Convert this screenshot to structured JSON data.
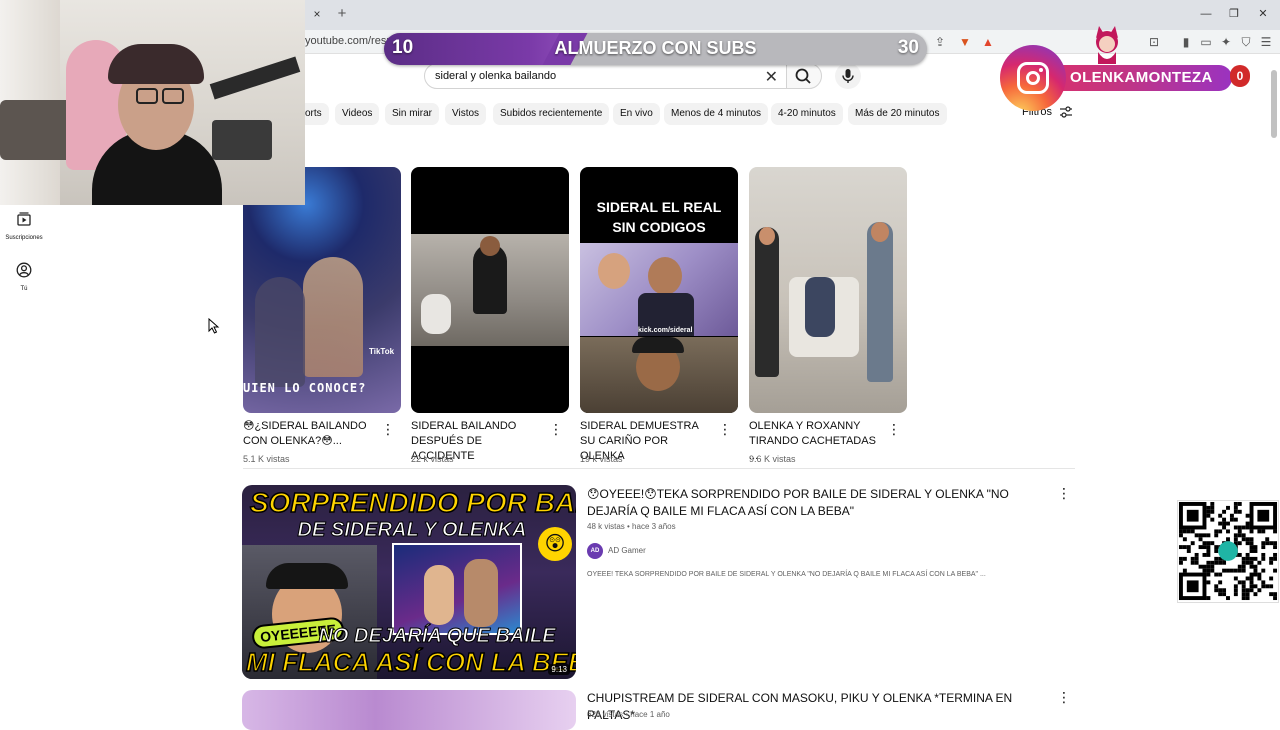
{
  "browser": {
    "url": "youtube.com/resul",
    "tab_close": "×",
    "tab_new": "+"
  },
  "overlay": {
    "goal_current": "10",
    "goal_title": "ALMUERZO CON SUBS",
    "goal_target": "30",
    "goal_progress": 0.333,
    "instagram_handle": "OLENKAMONTEZA",
    "instagram_count": "0",
    "colors": {
      "goal_fill": "#6b3399",
      "instagram": "#c13584"
    }
  },
  "search": {
    "query": "sideral y olenka bailando"
  },
  "chips": [
    "orts",
    "Videos",
    "Sin mirar",
    "Vistos",
    "Subidos recientemente",
    "En vivo",
    "Menos de 4 minutos",
    "4-20 minutos",
    "Más de 20 minutos"
  ],
  "filters_label": "Filtros",
  "sidebar": {
    "subscriptions": "Suscripciones",
    "you": "Tú"
  },
  "shorts": [
    {
      "title": "😳¿SIDERAL BAILANDO CON OLENKA?😳...",
      "views": "5.1 K vistas",
      "overlay_text": "UIEN LO CONOCE?",
      "badge": "TikTok"
    },
    {
      "title": "SIDERAL BAILANDO DESPUÉS DE ACCIDENTE",
      "views": "22 k vistas"
    },
    {
      "title": "SIDERAL DEMUESTRA SU CARIÑO POR OLENKA",
      "views": "19 k vistas",
      "overlay_text": "SIDERAL EL REAL SIN CODIGOS",
      "watermark": "kick.com/sideral"
    },
    {
      "title": "OLENKA Y ROXANNY TIRANDO CACHETADAS ...",
      "views": "9.6 K vistas"
    }
  ],
  "videos": [
    {
      "title": "😯OYEEE!😯TEKA SORPRENDIDO POR BAILE DE SIDERAL Y OLENKA \"NO DEJARÍA Q BAILE MI FLACA ASÍ CON LA BEBA\"",
      "meta": "48 k vistas • hace 3 años",
      "channel": "AD Gamer",
      "channel_initials": "AD",
      "description": "OYEEE! TEKA SORPRENDIDO POR BAILE DE SIDERAL Y OLENKA \"NO DEJARÍA Q BAILE MI FLACA ASÍ CON LA BEBA\" ...",
      "duration": "9:13",
      "thumb_top_text": "SORPRENDIDO POR BAILE",
      "thumb_mid_text": "DE SIDERAL Y OLENKA",
      "thumb_bubble": "OYEEEEEE",
      "thumb_bottom1": "NO DEJARÍA QUE BAILE",
      "thumb_bottom2": "MI FLACA ASÍ CON LA BEBA"
    },
    {
      "title": "CHUPISTREAM DE SIDERAL CON MASOKU, PIKU Y OLENKA *TERMINA EN PALTAS*",
      "meta": "628 vistas • hace 1 año"
    }
  ]
}
